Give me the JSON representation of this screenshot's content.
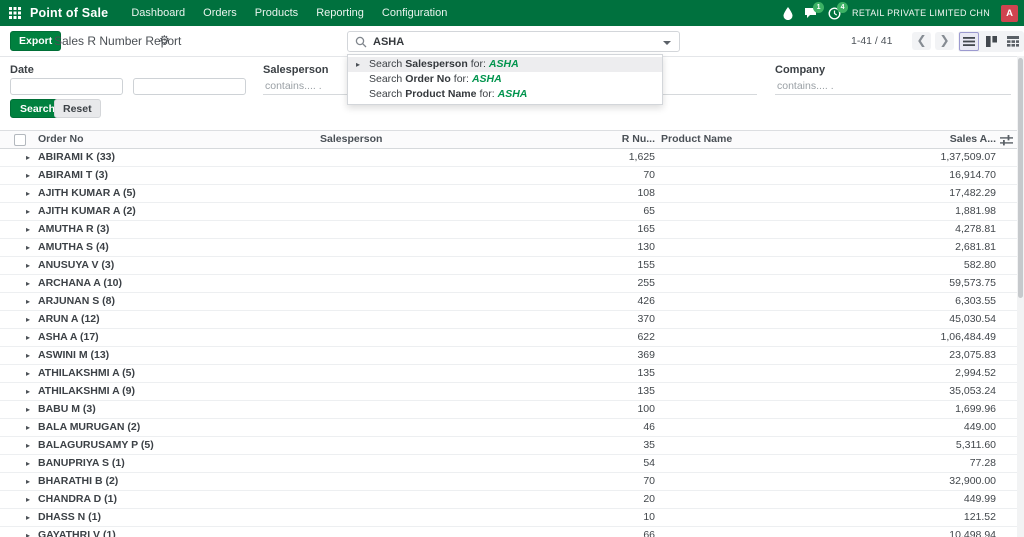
{
  "navbar": {
    "app_name": "Point of Sale",
    "items": [
      {
        "label": "Dashboard"
      },
      {
        "label": "Orders"
      },
      {
        "label": "Products"
      },
      {
        "label": "Reporting"
      },
      {
        "label": "Configuration"
      }
    ],
    "right": {
      "chat_badge": "1",
      "clock_badge": "4",
      "company": "RETAIL PRIVATE LIMITED CHN",
      "avatar_letter": "A"
    }
  },
  "control_bar": {
    "export_label": "Export",
    "title": "Sales R Number Report",
    "search_value": "ASHA",
    "pager": "1-41 / 41"
  },
  "search_dropdown": {
    "options": [
      {
        "prefix": "Search",
        "field": "Salesperson",
        "mid": "for:",
        "term": "ASHA"
      },
      {
        "prefix": "Search",
        "field": "Order No",
        "mid": "for:",
        "term": "ASHA"
      },
      {
        "prefix": "Search",
        "field": "Product Name",
        "mid": "for:",
        "term": "ASHA"
      }
    ]
  },
  "filters": {
    "date_label": "Date",
    "salesperson_label": "Salesperson",
    "company_label": "Company",
    "contains_placeholder": "contains.... .",
    "search_label": "Search",
    "reset_label": "Reset"
  },
  "table": {
    "headers": {
      "order_no": "Order No",
      "salesperson": "Salesperson",
      "r_number": "R Nu...",
      "product_name": "Product Name",
      "sales_amount": "Sales A..."
    },
    "rows": [
      {
        "name": "ABIRAMI K (33)",
        "r_number": "1,625",
        "sales_amount": "1,37,509.07"
      },
      {
        "name": "ABIRAMI T (3)",
        "r_number": "70",
        "sales_amount": "16,914.70"
      },
      {
        "name": "AJITH KUMAR A (5)",
        "r_number": "108",
        "sales_amount": "17,482.29"
      },
      {
        "name": "AJITH KUMAR A (2)",
        "r_number": "65",
        "sales_amount": "1,881.98"
      },
      {
        "name": "AMUTHA R (3)",
        "r_number": "165",
        "sales_amount": "4,278.81"
      },
      {
        "name": "AMUTHA S (4)",
        "r_number": "130",
        "sales_amount": "2,681.81"
      },
      {
        "name": "ANUSUYA V (3)",
        "r_number": "155",
        "sales_amount": "582.80"
      },
      {
        "name": "ARCHANA A (10)",
        "r_number": "255",
        "sales_amount": "59,573.75"
      },
      {
        "name": "ARJUNAN S (8)",
        "r_number": "426",
        "sales_amount": "6,303.55"
      },
      {
        "name": "ARUN A (12)",
        "r_number": "370",
        "sales_amount": "45,030.54"
      },
      {
        "name": "ASHA A (17)",
        "r_number": "622",
        "sales_amount": "1,06,484.49"
      },
      {
        "name": "ASWINI M (13)",
        "r_number": "369",
        "sales_amount": "23,075.83"
      },
      {
        "name": "ATHILAKSHMI A (5)",
        "r_number": "135",
        "sales_amount": "2,994.52"
      },
      {
        "name": "ATHILAKSHMI A (9)",
        "r_number": "135",
        "sales_amount": "35,053.24"
      },
      {
        "name": "BABU M (3)",
        "r_number": "100",
        "sales_amount": "1,699.96"
      },
      {
        "name": "BALA MURUGAN (2)",
        "r_number": "46",
        "sales_amount": "449.00"
      },
      {
        "name": "BALAGURUSAMY P (5)",
        "r_number": "35",
        "sales_amount": "5,311.60"
      },
      {
        "name": "BANUPRIYA S (1)",
        "r_number": "54",
        "sales_amount": "77.28"
      },
      {
        "name": "BHARATHI B (2)",
        "r_number": "70",
        "sales_amount": "32,900.00"
      },
      {
        "name": "CHANDRA D (1)",
        "r_number": "20",
        "sales_amount": "449.99"
      },
      {
        "name": "DHASS N (1)",
        "r_number": "10",
        "sales_amount": "121.52"
      },
      {
        "name": "GAYATHRI V (1)",
        "r_number": "66",
        "sales_amount": "10,498.94"
      }
    ]
  },
  "icons": {
    "apps_grid": "3x3-grid",
    "droplet": "teardrop",
    "chat": "speech-bubble",
    "clock": "clock-face",
    "gear": "⚙",
    "magnifier": "search-lens",
    "caret": "▾",
    "row_expander": "▸",
    "list_view": "horizontal-bars",
    "kanban_view": "columns",
    "pivot_view": "grid-table",
    "column_options": "sliders"
  },
  "colors": {
    "navbar_green": "#00713e",
    "button_green": "#00813f",
    "term_green": "#00944d",
    "avatar_red": "#cf4450",
    "badge_green": "#3cb164"
  }
}
